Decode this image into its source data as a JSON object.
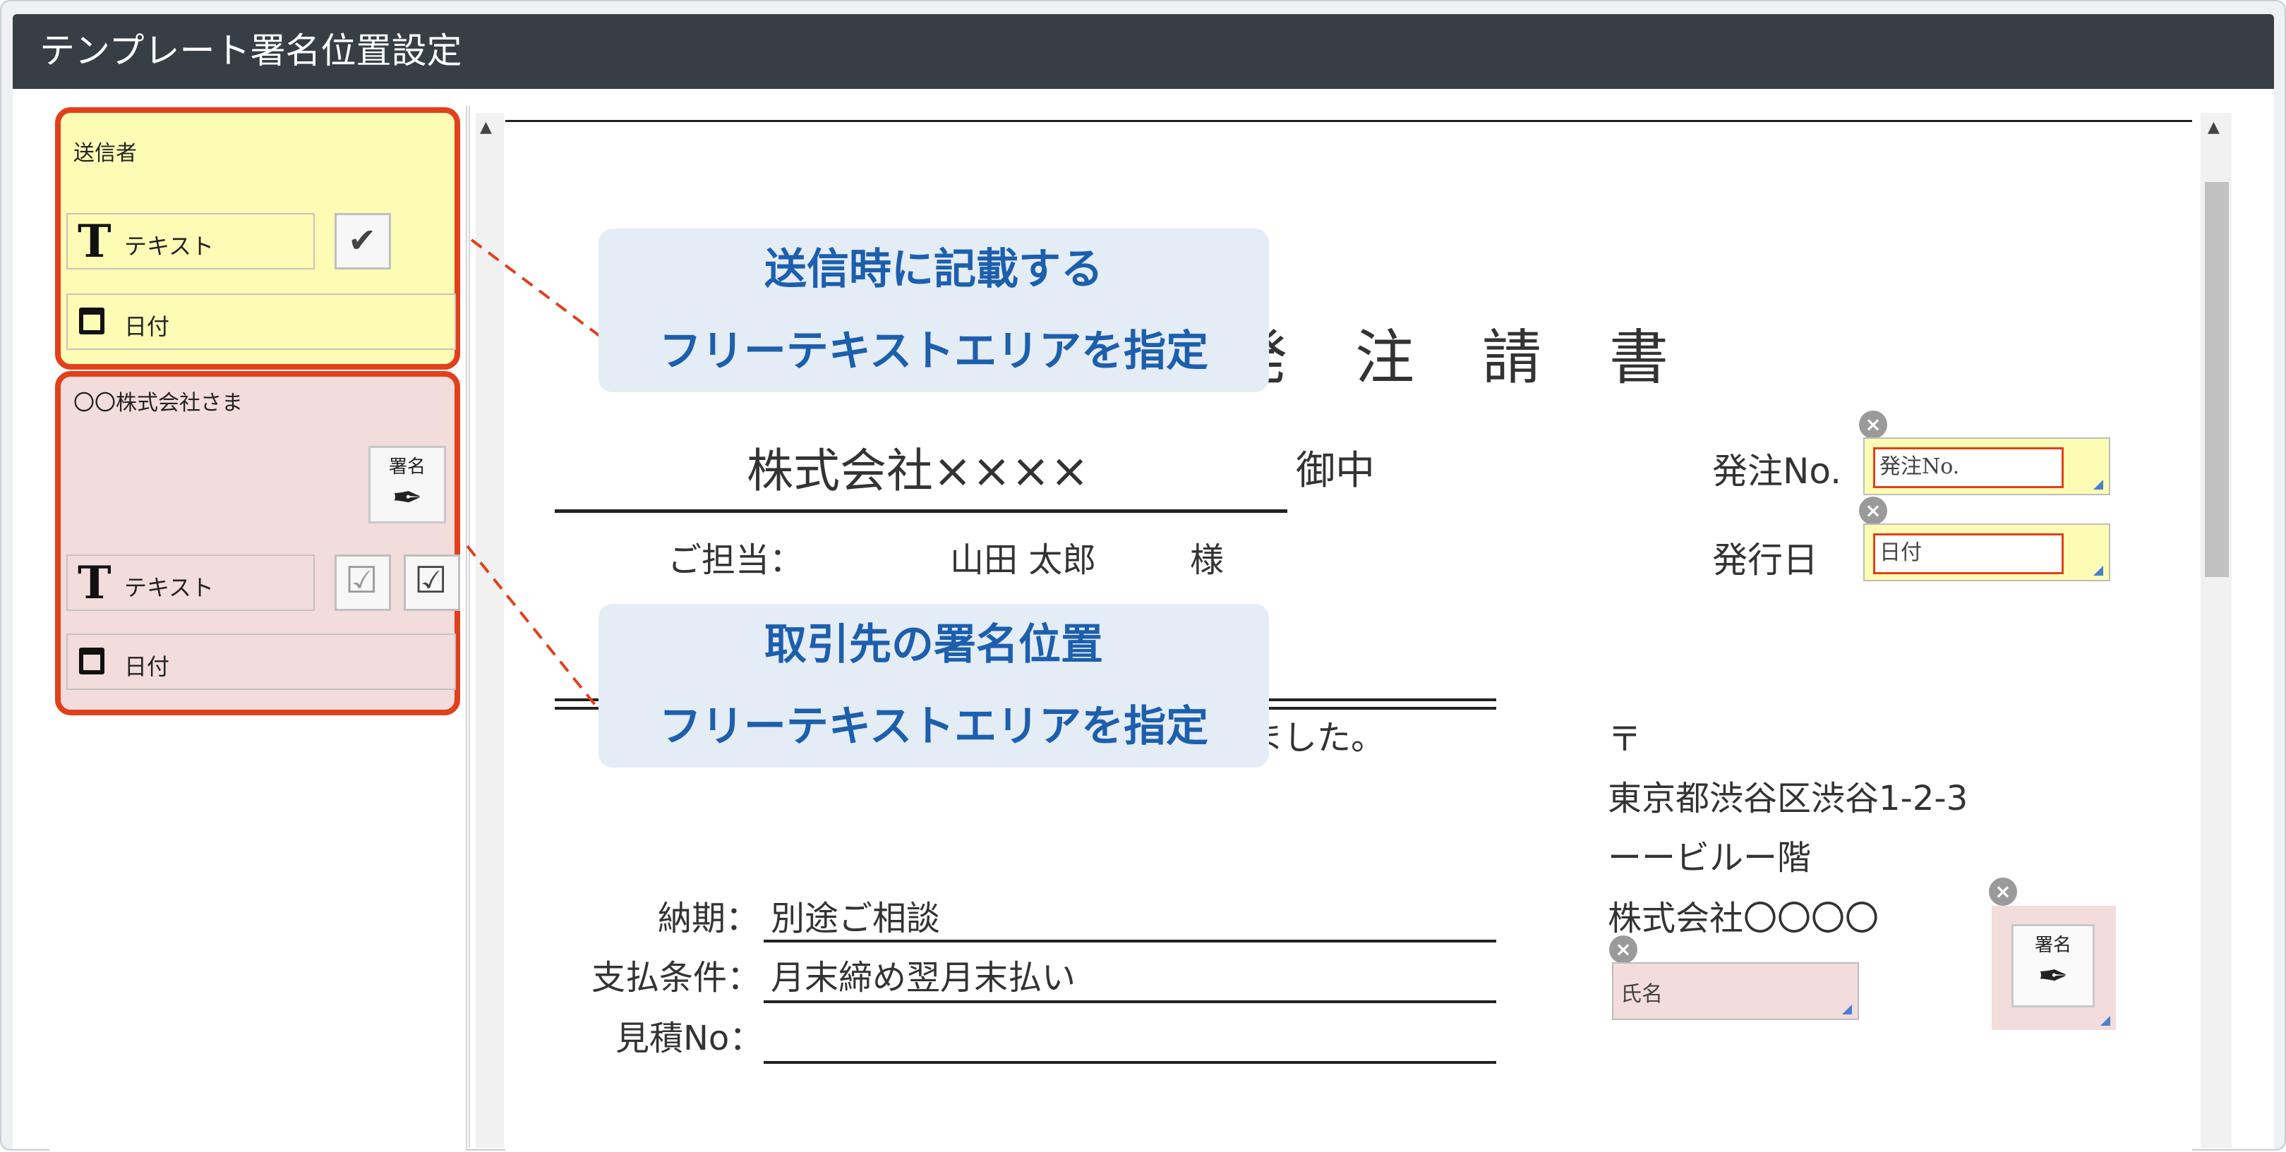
{
  "window": {
    "title": "テンプレート署名位置設定"
  },
  "sidebar": {
    "sender": {
      "title": "送信者",
      "text_label": "テキスト",
      "date_label": "日付"
    },
    "client": {
      "title": "〇〇株式会社さま",
      "sign_label": "署名",
      "text_label": "テキスト",
      "date_label": "日付"
    }
  },
  "callouts": {
    "top": {
      "line1": "送信時に記載する",
      "line2": "フリーテキストエリアを指定"
    },
    "bottom": {
      "line1": "取引先の署名位置",
      "line2": "フリーテキストエリアを指定"
    }
  },
  "document": {
    "heading": "発　注　請　書",
    "company": "株式会社××××",
    "onchu": "御中",
    "tanto_label": "ご担当：",
    "tanto_name": "山田 太郎",
    "sama": "様",
    "order_no_label": "発注No.",
    "order_no_placeholder": "発注No.",
    "issue_date_label": "発行日",
    "issue_date_placeholder": "日付",
    "body_fragment": "ました。",
    "postal_mark": "〒",
    "address1": "東京都渋谷区渋谷1-2-3",
    "address2": "ーービルー階",
    "sender_company": "株式会社〇〇〇〇",
    "name_placeholder": "氏名",
    "sign_label": "署名",
    "nouki_label": "納期：",
    "nouki_value": "別途ご相談",
    "payment_label": "支払条件：",
    "payment_value": "月末締め翌月末払い",
    "estimate_label": "見積No："
  },
  "colors": {
    "titlebar": "#383e46",
    "accent_orange": "#e2401b",
    "sender_bg": "#fdfcb5",
    "client_bg": "#f2dcdc",
    "callout_bg": "#e4ecf5",
    "callout_text": "#1d5fad"
  }
}
